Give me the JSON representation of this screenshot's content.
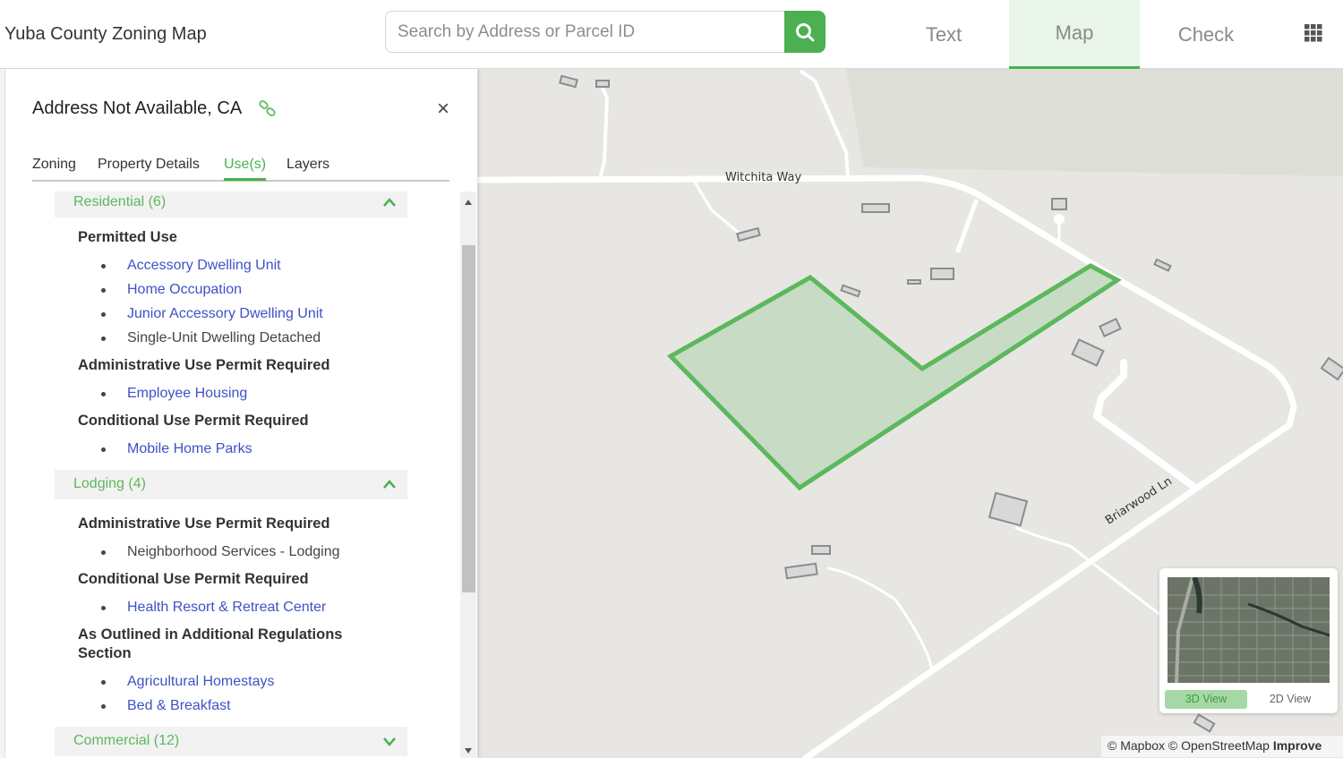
{
  "header": {
    "app_title": "Yuba County Zoning Map",
    "search": {
      "placeholder": "Search by Address or Parcel ID",
      "value": ""
    },
    "nav_tabs": [
      {
        "label": "Text",
        "active": false
      },
      {
        "label": "Map",
        "active": true
      },
      {
        "label": "Check",
        "active": false
      }
    ],
    "icons": {
      "search": "search-icon",
      "apps": "grid-icon"
    }
  },
  "panel": {
    "title": "Address Not Available, CA",
    "icons": {
      "link": "link-icon",
      "close": "close-icon"
    },
    "close_glyph": "×",
    "tabs": [
      {
        "label": "Zoning",
        "active": false
      },
      {
        "label": "Property Details",
        "active": false
      },
      {
        "label": "Use(s)",
        "active": true
      },
      {
        "label": "Layers",
        "active": false
      }
    ],
    "categories": [
      {
        "label": "Residential (6)",
        "expanded": true,
        "sections": [
          {
            "title": "Permitted Use",
            "items": [
              {
                "text": "Accessory Dwelling Unit",
                "link": true
              },
              {
                "text": "Home Occupation",
                "link": true
              },
              {
                "text": "Junior Accessory Dwelling Unit",
                "link": true
              },
              {
                "text": "Single-Unit Dwelling Detached",
                "link": false
              }
            ]
          },
          {
            "title": "Administrative Use Permit Required",
            "items": [
              {
                "text": "Employee Housing",
                "link": true
              }
            ]
          },
          {
            "title": "Conditional Use Permit Required",
            "items": [
              {
                "text": "Mobile Home Parks",
                "link": true
              }
            ]
          }
        ]
      },
      {
        "label": "Lodging (4)",
        "expanded": true,
        "sections": [
          {
            "title": "Administrative Use Permit Required",
            "items": [
              {
                "text": "Neighborhood Services - Lodging",
                "link": false
              }
            ]
          },
          {
            "title": "Conditional Use Permit Required",
            "items": [
              {
                "text": "Health Resort & Retreat Center",
                "link": true
              }
            ]
          },
          {
            "title": "As Outlined in Additional Regulations Section",
            "items": [
              {
                "text": "Agricultural Homestays",
                "link": true
              },
              {
                "text": "Bed & Breakfast",
                "link": true
              }
            ]
          }
        ]
      },
      {
        "label": "Commercial (12)",
        "expanded": false,
        "sections": []
      }
    ]
  },
  "map": {
    "road_labels": [
      "Witchita Way",
      "Briarwood Ln"
    ],
    "parcel_color": "#5cb85c",
    "minimap": {
      "btn_3d": "3D View",
      "btn_2d": "2D View",
      "active": "3D View"
    },
    "attribution": {
      "mapbox": "© Mapbox",
      "osm": "© OpenStreetMap",
      "improve": "Improve"
    }
  },
  "colors": {
    "accent": "#4caf50",
    "link": "#3f51c5",
    "active_tab_bg": "#eaf5ea"
  }
}
